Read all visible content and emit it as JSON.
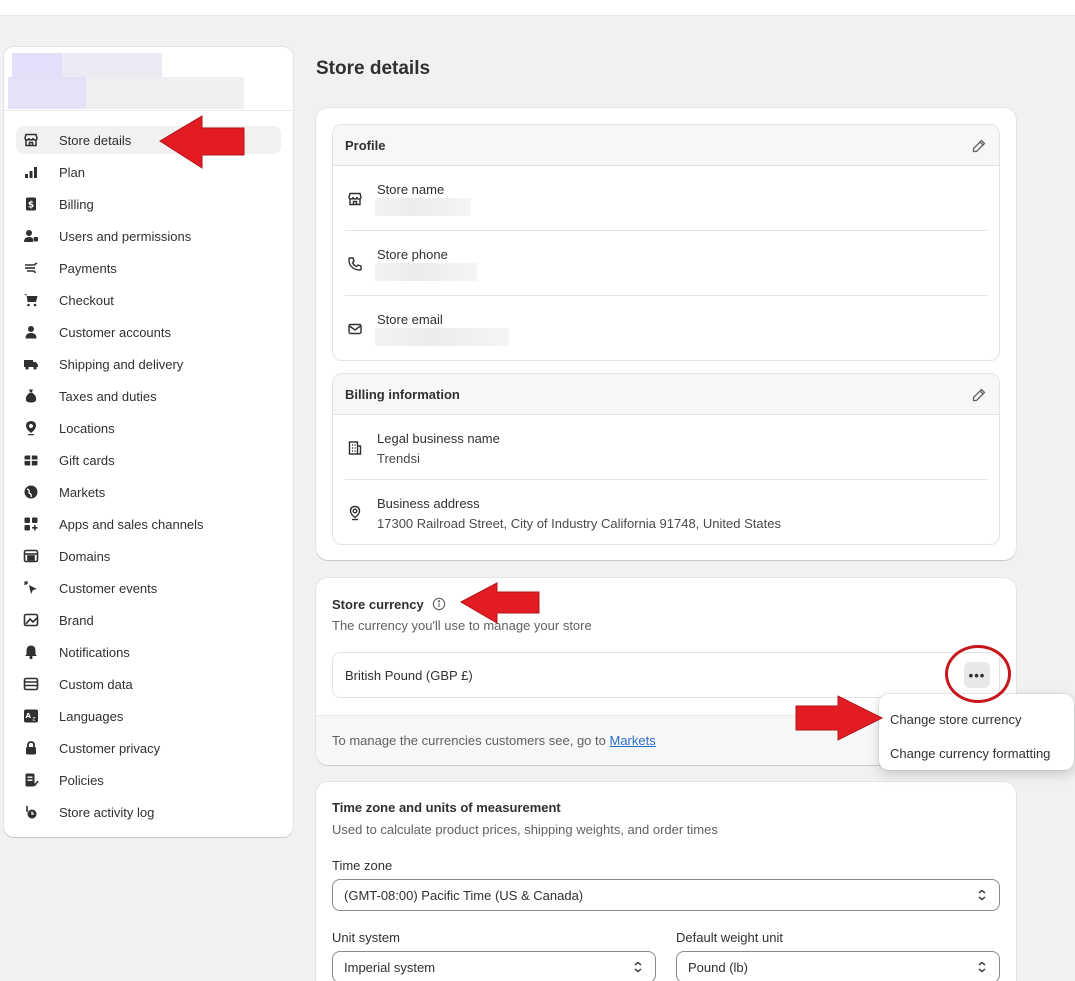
{
  "page": {
    "title": "Store details"
  },
  "sidebar": {
    "items": [
      {
        "label": "Store details",
        "icon": "store-icon"
      },
      {
        "label": "Plan",
        "icon": "plan-icon"
      },
      {
        "label": "Billing",
        "icon": "billing-icon"
      },
      {
        "label": "Users and permissions",
        "icon": "users-icon"
      },
      {
        "label": "Payments",
        "icon": "payments-icon"
      },
      {
        "label": "Checkout",
        "icon": "cart-icon"
      },
      {
        "label": "Customer accounts",
        "icon": "person-icon"
      },
      {
        "label": "Shipping and delivery",
        "icon": "truck-icon"
      },
      {
        "label": "Taxes and duties",
        "icon": "money-bag-icon"
      },
      {
        "label": "Locations",
        "icon": "location-pin-icon"
      },
      {
        "label": "Gift cards",
        "icon": "gift-card-icon"
      },
      {
        "label": "Markets",
        "icon": "globe-icon"
      },
      {
        "label": "Apps and sales channels",
        "icon": "apps-icon"
      },
      {
        "label": "Domains",
        "icon": "domains-icon"
      },
      {
        "label": "Customer events",
        "icon": "cursor-icon"
      },
      {
        "label": "Brand",
        "icon": "brand-icon"
      },
      {
        "label": "Notifications",
        "icon": "bell-icon"
      },
      {
        "label": "Custom data",
        "icon": "custom-data-icon"
      },
      {
        "label": "Languages",
        "icon": "language-icon"
      },
      {
        "label": "Customer privacy",
        "icon": "lock-icon"
      },
      {
        "label": "Policies",
        "icon": "policies-icon"
      },
      {
        "label": "Store activity log",
        "icon": "activity-log-icon"
      }
    ]
  },
  "profile": {
    "title": "Profile",
    "store_name_label": "Store name",
    "store_phone_label": "Store phone",
    "store_email_label": "Store email"
  },
  "billing_info": {
    "title": "Billing information",
    "legal_name_label": "Legal business name",
    "legal_name_value": "Trendsi",
    "address_label": "Business address",
    "address_value": "17300 Railroad Street, City of Industry California 91748, United States"
  },
  "currency": {
    "title": "Store currency",
    "subtitle": "The currency you'll use to manage your store",
    "value": "British Pound (GBP £)",
    "more_label": "•••",
    "footer_text": "To manage the currencies customers see, go to ",
    "footer_link": "Markets",
    "menu": [
      "Change store currency",
      "Change currency formatting"
    ]
  },
  "timezone": {
    "title": "Time zone and units of measurement",
    "subtitle": "Used to calculate product prices, shipping weights, and order times",
    "tz_label": "Time zone",
    "tz_value": "(GMT-08:00) Pacific Time (US & Canada)",
    "unit_label": "Unit system",
    "unit_value": "Imperial system",
    "weight_label": "Default weight unit",
    "weight_value": "Pound (lb)"
  },
  "colors": {
    "accent_red": "#e31c23",
    "link": "#2c6ecb",
    "background": "#f1f1f1"
  }
}
